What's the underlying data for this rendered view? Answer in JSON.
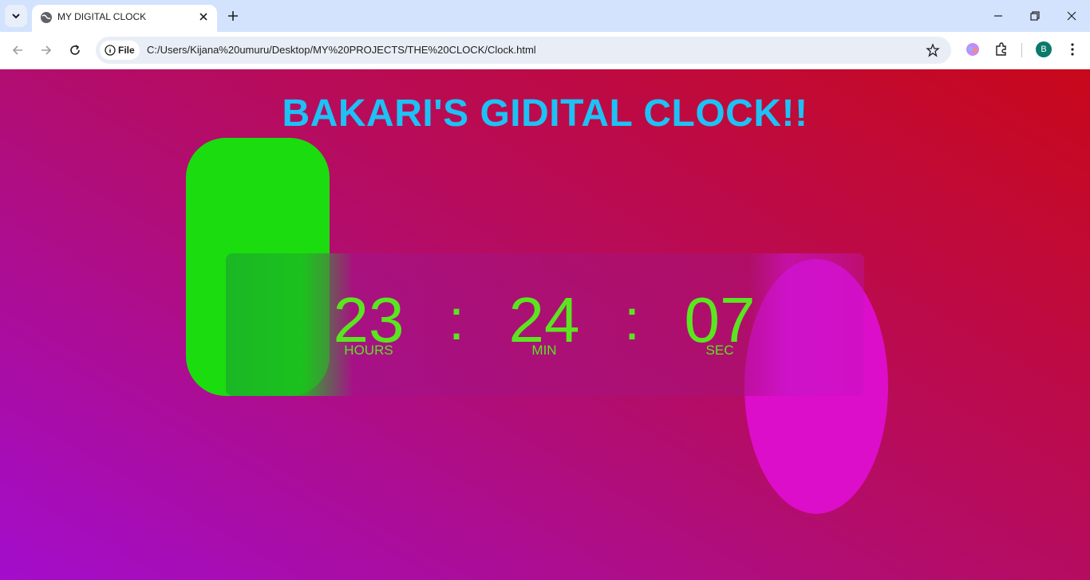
{
  "browser": {
    "tab_title": "MY DIGITAL CLOCK",
    "site_chip": "File",
    "url": "C:/Users/Kijana%20umuru/Desktop/MY%20PROJECTS/THE%20CLOCK/Clock.html",
    "avatar_letter": "B"
  },
  "page": {
    "heading": "BAKARI'S GIDITAL CLOCK!!",
    "clock": {
      "hours": "23",
      "minutes": "24",
      "seconds": "07",
      "separator": ":",
      "hours_label": "HOURS",
      "minutes_label": "MIN",
      "seconds_label": "SEC"
    }
  },
  "colors": {
    "heading": "#1ec1f5",
    "digits": "#5ae61f",
    "green_shape": "#1bdc0e",
    "pink_shape": "#dc0ec9"
  }
}
